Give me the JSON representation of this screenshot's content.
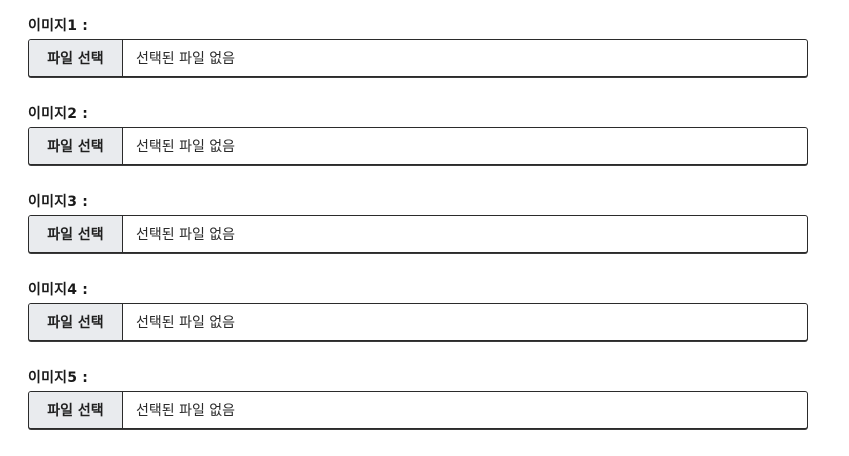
{
  "fields": [
    {
      "label": "이미지1 :",
      "button_label": "파일 선택",
      "status": "선택된 파일 없음"
    },
    {
      "label": "이미지2 :",
      "button_label": "파일 선택",
      "status": "선택된 파일 없음"
    },
    {
      "label": "이미지3 :",
      "button_label": "파일 선택",
      "status": "선택된 파일 없음"
    },
    {
      "label": "이미지4 :",
      "button_label": "파일 선택",
      "status": "선택된 파일 없음"
    },
    {
      "label": "이미지5 :",
      "button_label": "파일 선택",
      "status": "선택된 파일 없음"
    }
  ]
}
